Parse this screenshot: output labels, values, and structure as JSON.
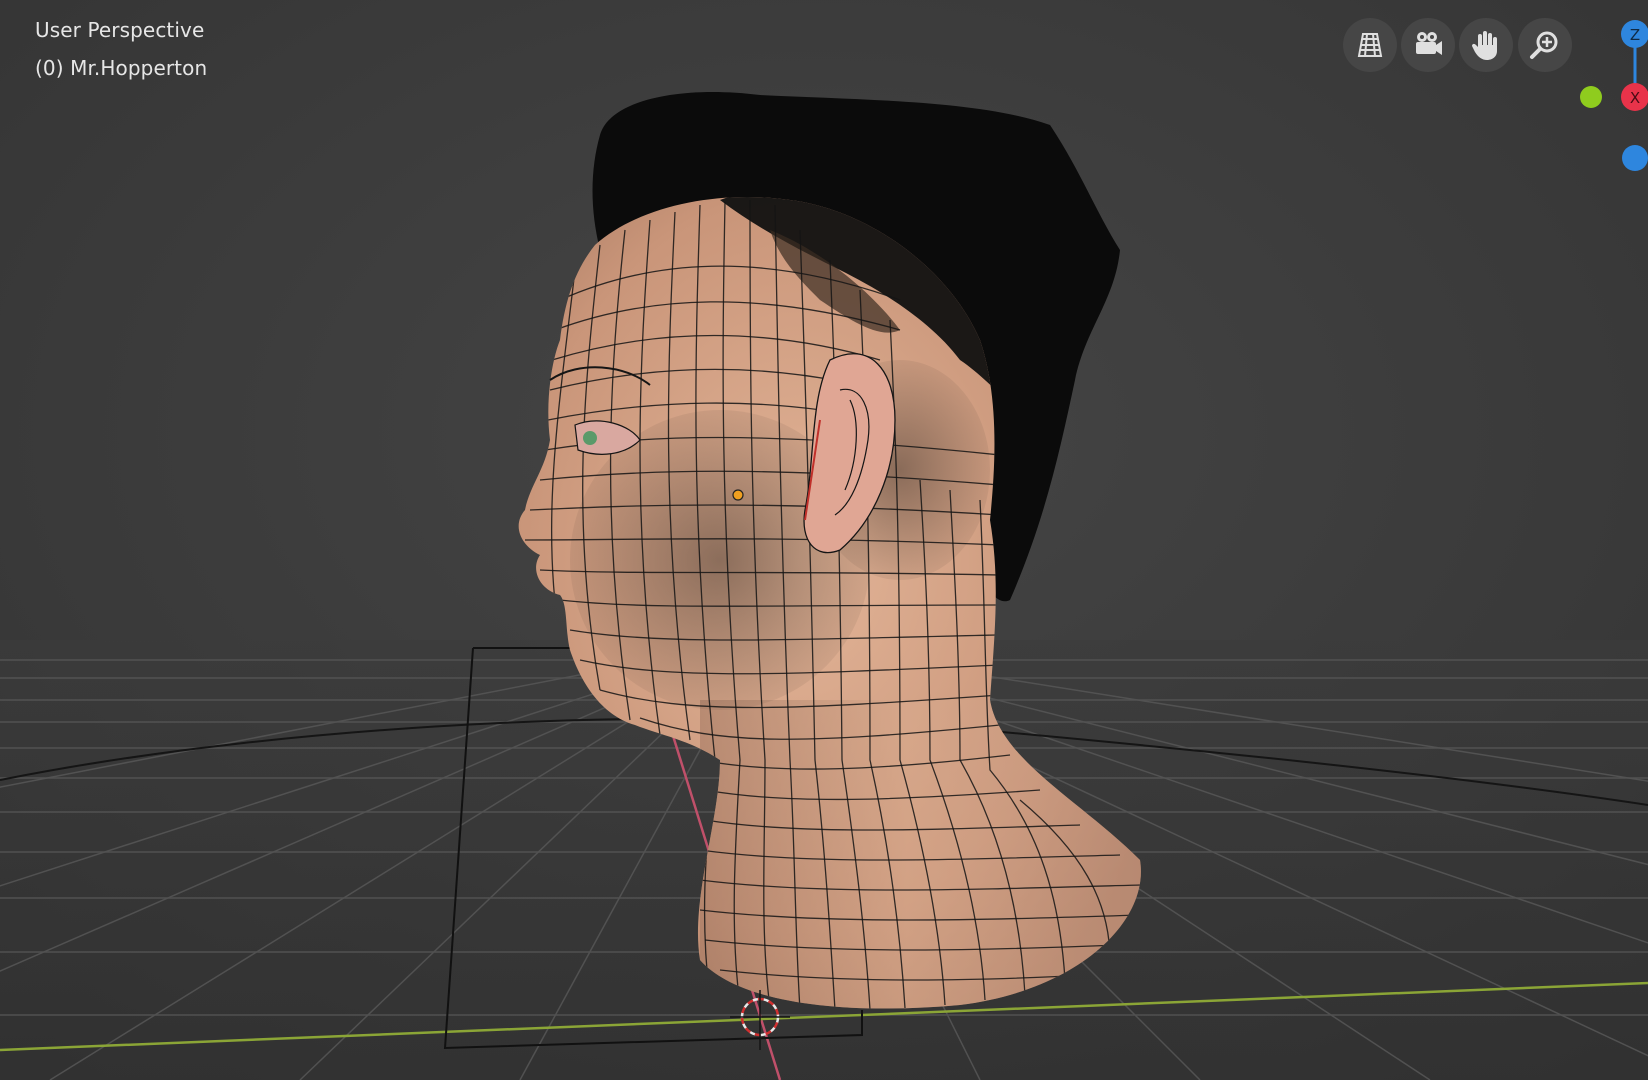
{
  "viewport": {
    "view_name": "User Perspective",
    "object_name": "(0) Mr.Hopperton"
  },
  "navigation": {
    "toggle_view": "grid-perspective-icon",
    "camera_view": "camera-icon",
    "pan_view": "hand-icon",
    "zoom_view": "zoom-icon"
  },
  "gizmo": {
    "z_label": "Z",
    "x_label": "X",
    "colors": {
      "x": "#e8334a",
      "y": "#8fcc1e",
      "z": "#2e86de"
    }
  },
  "scene": {
    "background": "#3d3d3d",
    "grid_color": "#555555",
    "x_axis_color": "#c04060",
    "y_axis_color": "#8aa830",
    "skin_color": "#d9a88a"
  }
}
